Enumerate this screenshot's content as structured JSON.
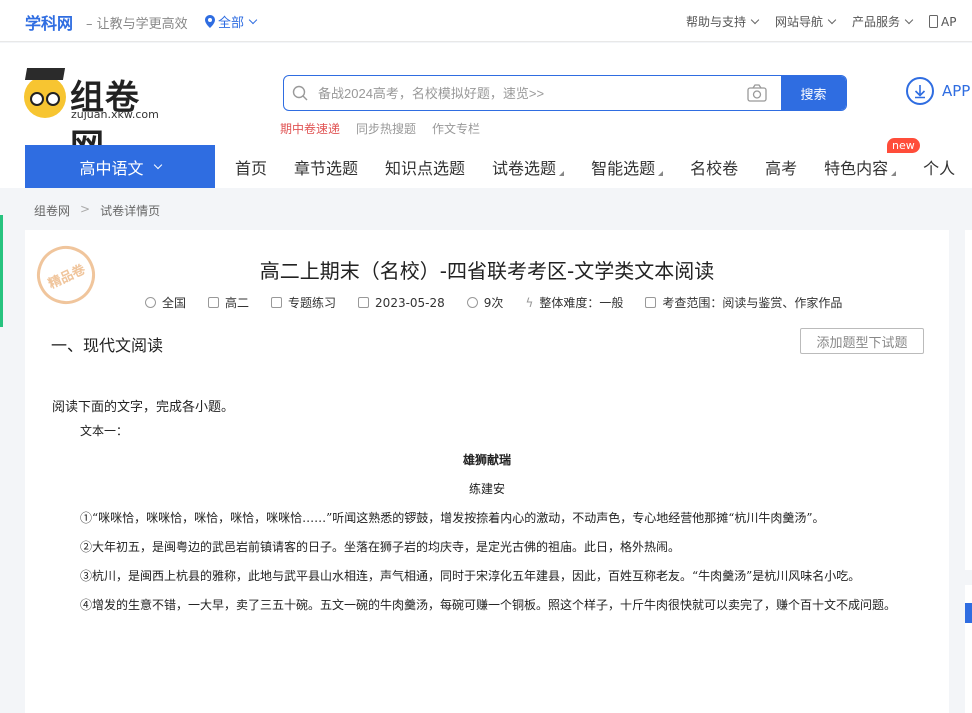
{
  "topbar": {
    "brand": "学科网",
    "slogan": "– 让教与学更高效",
    "region": "全部",
    "links": [
      "帮助与支持",
      "网站导航",
      "产品服务",
      "AP"
    ]
  },
  "logo": {
    "name": "组卷网",
    "url": "zujuan.xkw.com"
  },
  "search": {
    "placeholder": "备战2024高考，名校模拟好题，速览>>",
    "button": "搜索",
    "hot": [
      "期中卷速递",
      "同步热搜题",
      "作文专栏"
    ]
  },
  "app_label": "APP",
  "nav": {
    "subject": "高中语文",
    "items": [
      "首页",
      "章节选题",
      "知识点选题",
      "试卷选题",
      "智能选题",
      "名校卷",
      "高考",
      "特色内容",
      "个人"
    ],
    "badge": "new"
  },
  "breadcrumb": [
    "组卷网",
    ">",
    "试卷详情页"
  ],
  "paper": {
    "stamp": "精品卷",
    "title": "高二上期末（名校）-四省联考考区-文学类文本阅读",
    "meta": {
      "region": "全国",
      "grade": "高二",
      "type": "专题练习",
      "date": "2023-05-28",
      "views": "9次",
      "difficulty": "整体难度：一般",
      "scope": "考查范围：阅读与鉴赏、作家作品"
    },
    "section": "一、现代文阅读",
    "add_button": "添加题型下试题",
    "instruction": "阅读下面的文字，完成各小题。",
    "text_label": "文本一：",
    "story_title": "雄狮献瑞",
    "author": "练建安",
    "paragraphs": [
      "①“咪咪恰，咪咪恰，咪恰，咪恰，咪咪恰……”听闻这熟悉的锣鼓，增发按捺着内心的激动，不动声色，专心地经营他那摊“杭川牛肉羹汤”。",
      "②大年初五，是闽粤边的武邑岩前镇请客的日子。坐落在狮子岩的均庆寺，是定光古佛的祖庙。此日，格外热闹。",
      "③杭川，是闽西上杭县的雅称，此地与武平县山水相连，声气相通，同时于宋淳化五年建县，因此，百姓互称老友。“牛肉羹汤”是杭川风味名小吃。",
      "④增发的生意不错，一大早，卖了三五十碗。五文一碗的牛肉羹汤，每碗可赚一个铜板。照这个样子，十斤牛肉很快就可以卖完了，赚个百十文不成问题。"
    ]
  }
}
